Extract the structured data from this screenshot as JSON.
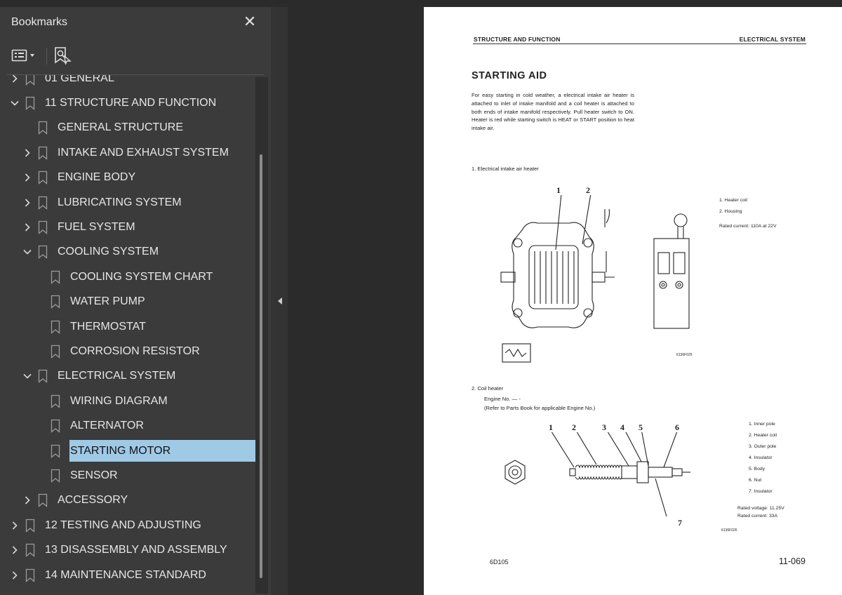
{
  "sidebar": {
    "title": "Bookmarks",
    "close_icon": "close-icon",
    "tools": {
      "options_icon": "bookmark-options-icon",
      "find_icon": "find-current-bookmark-icon"
    },
    "items": [
      {
        "label": "01 GENERAL",
        "level": 0,
        "state": "collapsed"
      },
      {
        "label": "11 STRUCTURE AND FUNCTION",
        "level": 0,
        "state": "expanded"
      },
      {
        "label": "GENERAL STRUCTURE",
        "level": 1,
        "state": "leaf"
      },
      {
        "label": "INTAKE AND EXHAUST SYSTEM",
        "level": 1,
        "state": "collapsed"
      },
      {
        "label": "ENGINE BODY",
        "level": 1,
        "state": "collapsed"
      },
      {
        "label": "LUBRICATING SYSTEM",
        "level": 1,
        "state": "collapsed"
      },
      {
        "label": "FUEL SYSTEM",
        "level": 1,
        "state": "collapsed"
      },
      {
        "label": "COOLING SYSTEM",
        "level": 1,
        "state": "expanded"
      },
      {
        "label": "COOLING SYSTEM CHART",
        "level": 2,
        "state": "leaf"
      },
      {
        "label": "WATER PUMP",
        "level": 2,
        "state": "leaf"
      },
      {
        "label": "THERMOSTAT",
        "level": 2,
        "state": "leaf"
      },
      {
        "label": "CORROSION RESISTOR",
        "level": 2,
        "state": "leaf"
      },
      {
        "label": "ELECTRICAL SYSTEM",
        "level": 1,
        "state": "expanded"
      },
      {
        "label": "WIRING DIAGRAM",
        "level": 2,
        "state": "leaf"
      },
      {
        "label": "ALTERNATOR",
        "level": 2,
        "state": "leaf"
      },
      {
        "label": "STARTING MOTOR",
        "level": 2,
        "state": "leaf",
        "selected": true
      },
      {
        "label": "SENSOR",
        "level": 2,
        "state": "leaf"
      },
      {
        "label": "ACCESSORY",
        "level": 1,
        "state": "collapsed"
      },
      {
        "label": "12 TESTING AND ADJUSTING",
        "level": 0,
        "state": "collapsed"
      },
      {
        "label": "13 DISASSEMBLY AND ASSEMBLY",
        "level": 0,
        "state": "collapsed"
      },
      {
        "label": "14 MAINTENANCE STANDARD",
        "level": 0,
        "state": "collapsed"
      }
    ]
  },
  "colors": {
    "selection": "#9fcae6",
    "panel": "#3b3b3b",
    "viewer": "#2b2b2b"
  },
  "document": {
    "header_left": "STRUCTURE AND FUNCTION",
    "header_right": "ELECTRICAL SYSTEM",
    "title": "STARTING AID",
    "paragraph": "For easy starting in cold weather, a electrical intake air heater is attached to inlet of intake manifold and a coil heater is attached to both ends of intake manifold respectively. Pull heater switch to ON. Heater is red while starting switch is HEAT or START position to heat intake air.",
    "section1": "1.   Electrical intake air heater",
    "fig1_callouts": [
      "1",
      "2"
    ],
    "fig1_legend": [
      "1.   Heater coil",
      "2.   Housing"
    ],
    "fig1_rated": "Rated current:  110A at 22V",
    "fig1_code": "6136F025",
    "section2": "2.   Coil heater",
    "engine_no": "Engine No. — -",
    "refer": "(Refer to Parts Book for applicable Engine No.)",
    "fig2_callouts": [
      "1",
      "2",
      "3",
      "4",
      "5",
      "6",
      "7"
    ],
    "fig2_legend": [
      "1.   Inner pole",
      "2.   Heater coil",
      "3.   Outer pole",
      "4.   Insulator",
      "5.   Body",
      "6.   Nut",
      "7.   Insulator"
    ],
    "fig2_rated_voltage": "Rated voltage: 11.25V",
    "fig2_rated_current": "Rated current:      33A",
    "fig2_code": "6136F026",
    "footer_left": "6D105",
    "footer_right": "11-069"
  }
}
